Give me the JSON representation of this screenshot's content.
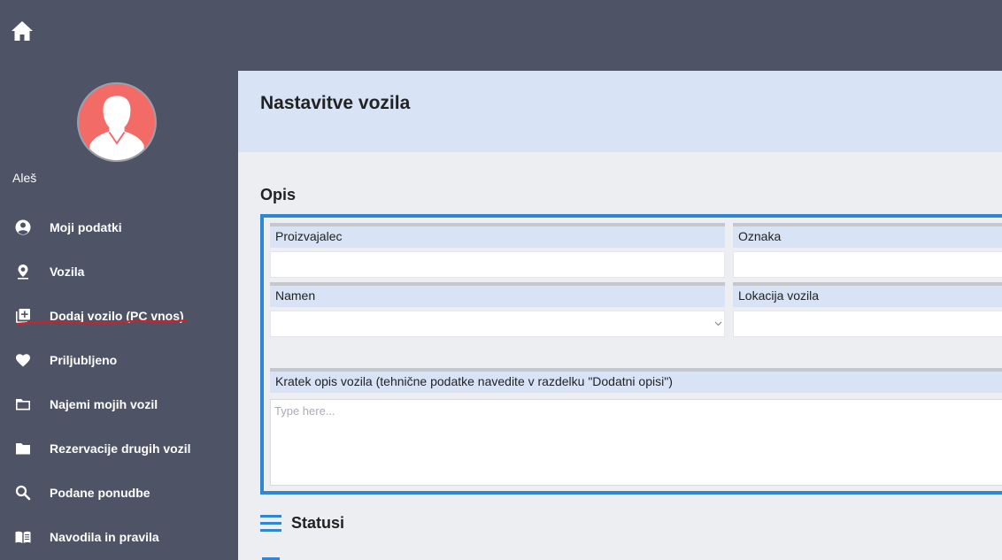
{
  "nav_home": {
    "icon": "home-icon"
  },
  "user": {
    "name": "Aleš",
    "avatar_icon": "user-avatar-icon"
  },
  "sidebar": {
    "items": [
      {
        "label": "Moji podatki",
        "icon": "account-circle-icon"
      },
      {
        "label": "Vozila",
        "icon": "location-pin-icon"
      },
      {
        "label": "Dodaj vozilo (PC vnos)",
        "icon": "library-add-icon"
      },
      {
        "label": "Priljubljeno",
        "icon": "heart-icon"
      },
      {
        "label": "Najemi mojih vozil",
        "icon": "folder-outline-icon"
      },
      {
        "label": "Rezervacije drugih vozil",
        "icon": "folder-icon"
      },
      {
        "label": "Podane ponudbe",
        "icon": "search-icon"
      },
      {
        "label": "Navodila in pravila",
        "icon": "book-icon"
      }
    ]
  },
  "main": {
    "title": "Nastavitve vozila",
    "section_opis": "Opis",
    "fields": {
      "proizvajalec": {
        "label": "Proizvajalec",
        "value": ""
      },
      "oznaka": {
        "label": "Oznaka",
        "value": ""
      },
      "namen": {
        "label": "Namen",
        "value": ""
      },
      "lokacija": {
        "label": "Lokacija vozila",
        "value": ""
      },
      "kratek_opis": {
        "label": "Kratek opis vozila (tehnične  podatke navedite v  razdelku \"Dodatni opisi\")",
        "placeholder": "Type here..."
      }
    },
    "section_statusi": "Statusi",
    "statusi_icon": "menu-lines-icon"
  },
  "colors": {
    "sidebar_bg": "#4e5466",
    "accent": "#2f87d3",
    "label_bg": "#d8e4f6",
    "avatar_bg": "#f36b67",
    "annotation_underline": "#d0202a"
  }
}
